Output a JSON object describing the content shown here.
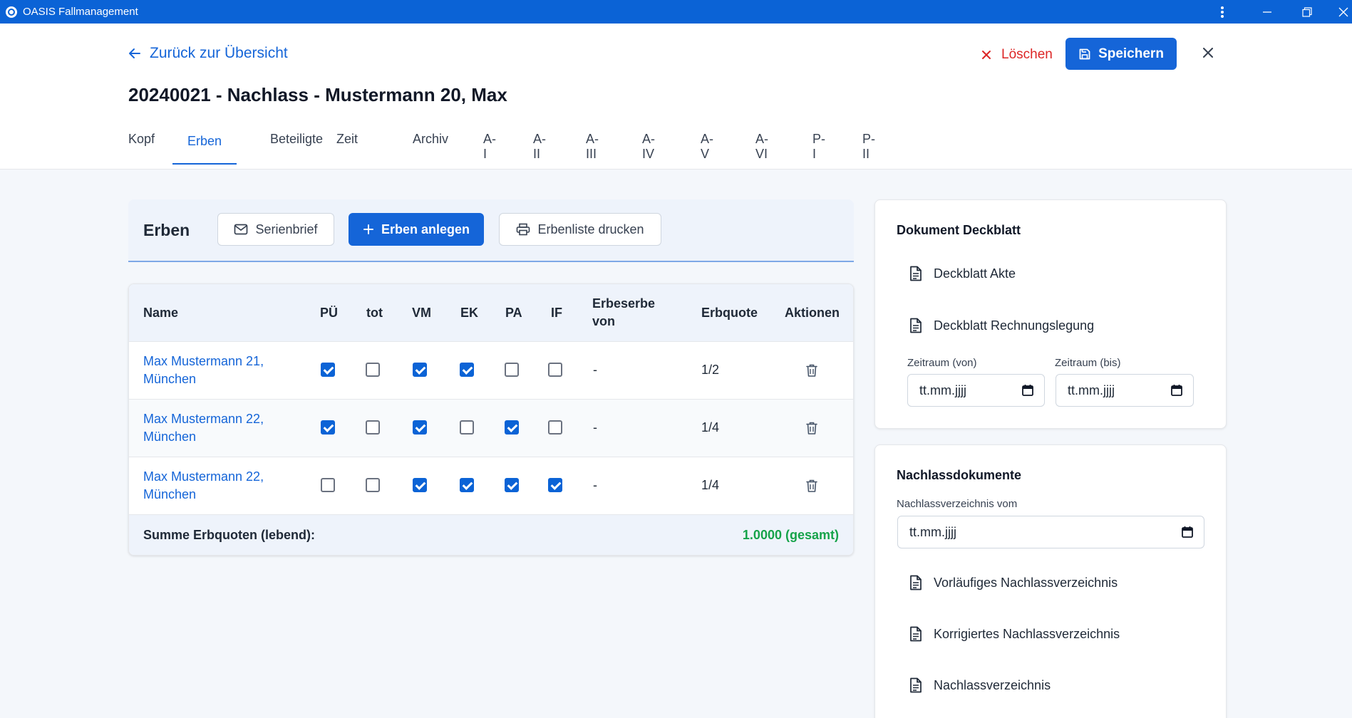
{
  "window": {
    "title": "OASIS Fallmanagement",
    "menu_icon": "more-vertical-icon",
    "minimize_icon": "minimize-icon",
    "restore_icon": "restore-icon",
    "close_icon": "close-icon"
  },
  "header": {
    "back_label": "Zurück zur Übersicht",
    "title": "20240021 - Nachlass - Mustermann 20, Max",
    "delete_label": "Löschen",
    "save_label": "Speichern"
  },
  "tabs": [
    {
      "label": "Kopf"
    },
    {
      "label": "Erben"
    },
    {
      "label": "Beteiligte"
    },
    {
      "label": "Zeit"
    },
    {
      "label": "Archiv"
    },
    {
      "label": "A-I"
    },
    {
      "label": "A-II"
    },
    {
      "label": "A-III"
    },
    {
      "label": "A-IV"
    },
    {
      "label": "A-V"
    },
    {
      "label": "A-VI"
    },
    {
      "label": "P-I"
    },
    {
      "label": "P-II"
    }
  ],
  "active_tab": "Erben",
  "erben": {
    "title": "Erben",
    "serienbrief_label": "Serienbrief",
    "anlegen_label": "Erben anlegen",
    "drucken_label": "Erbenliste drucken",
    "columns": {
      "name": "Name",
      "pu": "PÜ",
      "tot": "tot",
      "vm": "VM",
      "ek": "EK",
      "pa": "PA",
      "if": "IF",
      "erbeserbe_1": "Erbeserbe",
      "erbeserbe_2": "von",
      "erbquote": "Erbquote",
      "aktionen": "Aktionen"
    },
    "rows": [
      {
        "name_1": "Max Mustermann 21,",
        "name_2": "München",
        "pu": true,
        "tot": false,
        "vm": true,
        "ek": true,
        "pa": false,
        "if": false,
        "erbeserbe": "-",
        "erbquote": "1/2"
      },
      {
        "name_1": "Max Mustermann 22,",
        "name_2": "München",
        "pu": true,
        "tot": false,
        "vm": true,
        "ek": false,
        "pa": true,
        "if": false,
        "erbeserbe": "-",
        "erbquote": "1/4"
      },
      {
        "name_1": "Max Mustermann 22,",
        "name_2": "München",
        "pu": false,
        "tot": false,
        "vm": true,
        "ek": true,
        "pa": true,
        "if": true,
        "erbeserbe": "-",
        "erbquote": "1/4"
      }
    ],
    "sum_label": "Summe Erbquoten (lebend):",
    "sum_value": "1.0000 (gesamt)",
    "sum_color": "#16a34a"
  },
  "deckblatt": {
    "heading": "Dokument Deckblatt",
    "items": [
      "Deckblatt Akte",
      "Deckblatt Rechnungslegung"
    ],
    "von_label": "Zeitraum (von)",
    "bis_label": "Zeitraum (bis)",
    "von_value": "tt.mm.jjjj",
    "bis_value": "tt.mm.jjjj"
  },
  "nachlass": {
    "heading": "Nachlassdokumente",
    "date_label": "Nachlassverzeichnis vom",
    "date_value": "tt.mm.jjjj",
    "items": [
      "Vorläufiges Nachlassverzeichnis",
      "Korrigiertes Nachlassverzeichnis",
      "Nachlassverzeichnis"
    ]
  },
  "colors": {
    "primary": "#1565d8",
    "danger": "#dc2626",
    "success": "#16a34a",
    "titlebar": "#0b63d6"
  }
}
